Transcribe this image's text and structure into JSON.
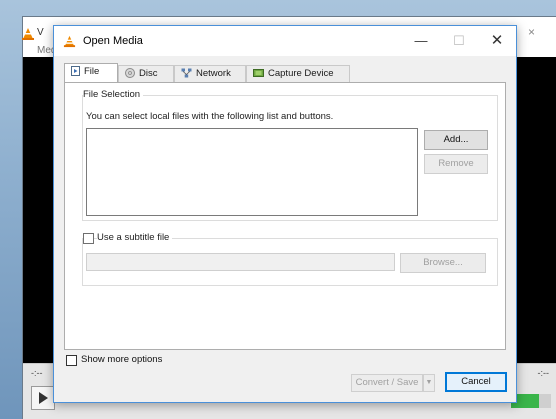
{
  "background_window": {
    "title_fragment": "V",
    "menu_fragment": "Medi",
    "close_glyph": "×",
    "time_left": "-:--",
    "time_right": "-:--",
    "volume_text": "%"
  },
  "dialog": {
    "title": "Open Media",
    "minimize_glyph": "—",
    "maximize_glyph": "☐",
    "close_glyph": "✕",
    "tabs": [
      {
        "label": "File",
        "icon": "file-icon",
        "active": true
      },
      {
        "label": "Disc",
        "icon": "disc-icon",
        "active": false
      },
      {
        "label": "Network",
        "icon": "network-icon",
        "active": false
      },
      {
        "label": "Capture Device",
        "icon": "capture-device-icon",
        "active": false
      }
    ],
    "file_selection": {
      "group_label": "File Selection",
      "description": "You can select local files with the following list and buttons.",
      "add_label": "Add...",
      "remove_label": "Remove"
    },
    "subtitle": {
      "checkbox_label": "Use a subtitle file",
      "checked": false,
      "browse_label": "Browse...",
      "path_value": ""
    },
    "show_more_options": {
      "label": "Show more options",
      "checked": false
    },
    "convert_save_label": "Convert / Save",
    "cancel_label": "Cancel"
  },
  "colors": {
    "accent": "#0078d7",
    "vlc_orange": "#f08a00",
    "window_border": "#4a90d9"
  }
}
